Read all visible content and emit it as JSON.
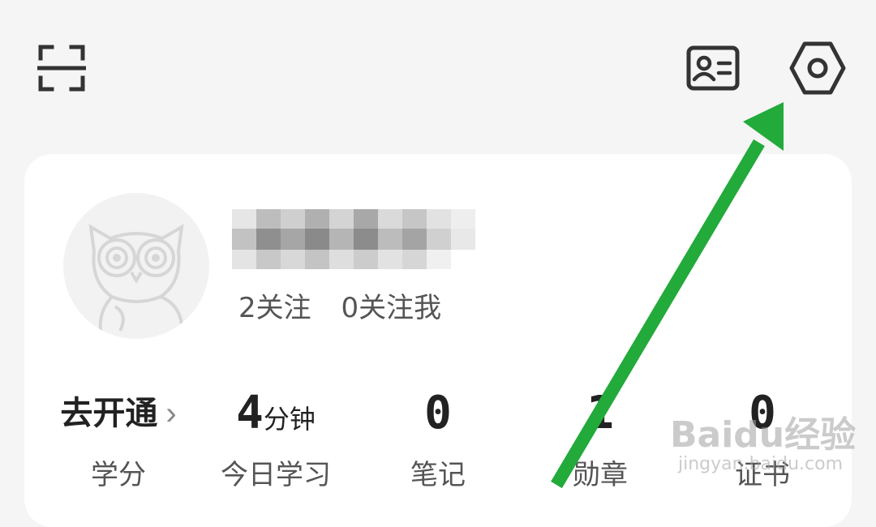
{
  "header": {
    "icons": [
      "scan-icon",
      "id-card-icon",
      "settings-icon"
    ]
  },
  "profile": {
    "username_blurred": "",
    "following_count_label": "2关注",
    "followers_count_label": "0关注我"
  },
  "stats": {
    "credit": {
      "value": "去开通",
      "label": "学分"
    },
    "today_study": {
      "value": "4",
      "unit": "分钟",
      "label": "今日学习"
    },
    "notes": {
      "value": "0",
      "label": "笔记"
    },
    "badges": {
      "value": "1",
      "label": "勋章"
    },
    "certificates": {
      "value": "0",
      "label": "证书"
    }
  },
  "watermark": {
    "line1": "Baidu经验",
    "line2": "jingyan.baidu.com"
  },
  "colors": {
    "background": "#f5f5f5",
    "card": "#ffffff",
    "arrow": "#22aa3a",
    "icon": "#333333"
  }
}
